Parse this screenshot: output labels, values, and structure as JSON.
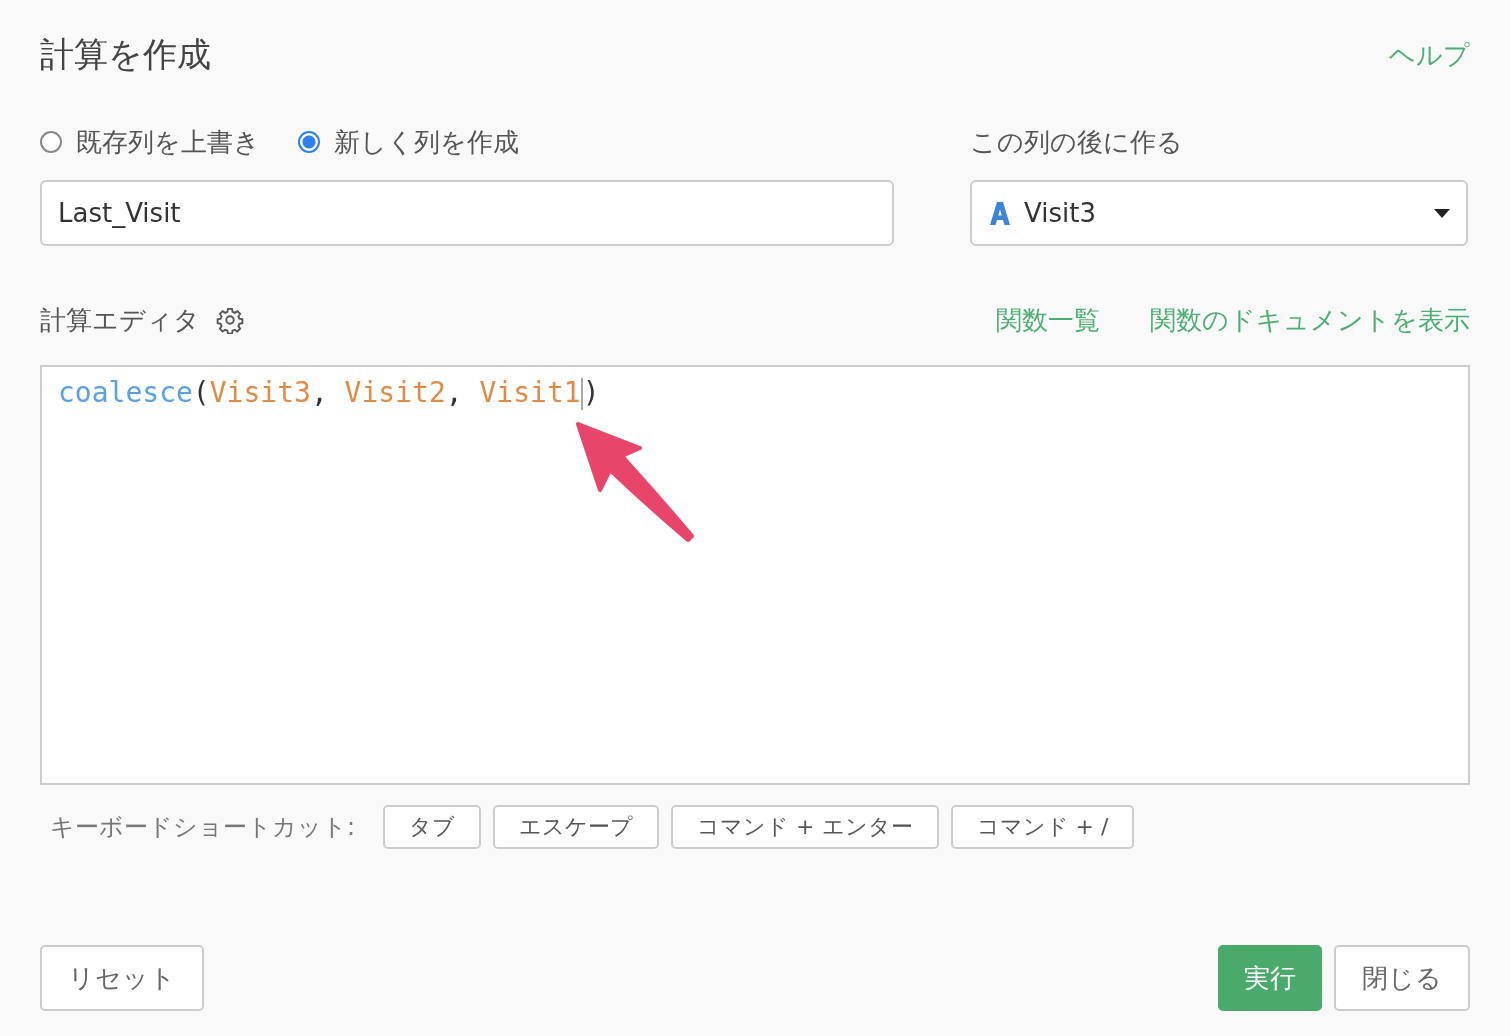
{
  "title": "計算を作成",
  "help_link": "ヘルプ",
  "mode_options": [
    {
      "label": "既存列を上書き",
      "selected": false
    },
    {
      "label": "新しく列を作成",
      "selected": true
    }
  ],
  "column_name": {
    "value": "Last_Visit"
  },
  "insert_after": {
    "label": "この列の後に作る",
    "value": "Visit3"
  },
  "editor": {
    "label": "計算エディタ",
    "links": [
      "関数一覧",
      "関数のドキュメントを表示"
    ],
    "code": [
      {
        "kind": "function",
        "text": "coalesce",
        "cursor": false
      },
      {
        "kind": "punct",
        "text": "(",
        "cursor": false
      },
      {
        "kind": "column",
        "text": "Visit3",
        "cursor": false
      },
      {
        "kind": "punct",
        "text": ", ",
        "cursor": false
      },
      {
        "kind": "column",
        "text": "Visit2",
        "cursor": false
      },
      {
        "kind": "punct",
        "text": ", ",
        "cursor": false
      },
      {
        "kind": "column",
        "text": "Visit1",
        "cursor": true
      },
      {
        "kind": "punct",
        "text": ")",
        "cursor": false
      }
    ]
  },
  "shortcuts": {
    "label": "キーボードショートカット:",
    "keys": [
      "タブ",
      "エスケープ",
      "コマンド + エンター",
      "コマンド + /"
    ]
  },
  "buttons": [
    {
      "kind": "secondary",
      "label": "リセット"
    },
    {
      "kind": "primary",
      "label": "実行"
    },
    {
      "kind": "secondary",
      "label": "閉じる"
    }
  ]
}
